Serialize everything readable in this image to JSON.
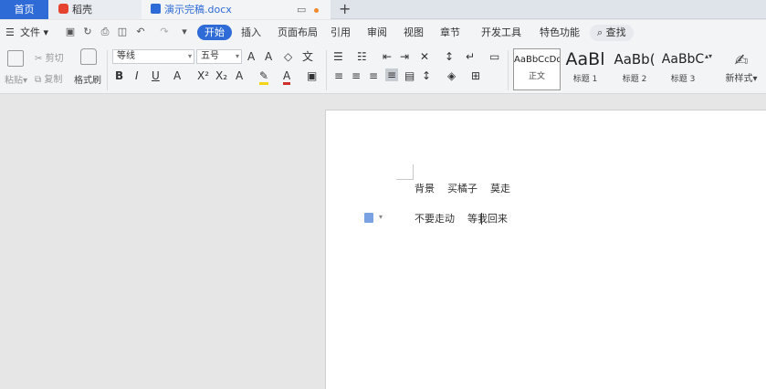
{
  "tabs": {
    "home": "首页",
    "daoke": "稻壳",
    "doc": "演示完稿.docx"
  },
  "menu": {
    "file": "文件",
    "items": [
      "开始",
      "插入",
      "页面布局",
      "引用",
      "审阅",
      "视图",
      "章节",
      "开发工具",
      "特色功能"
    ],
    "search": "查找"
  },
  "ribbon": {
    "paste": "粘贴",
    "cut": "剪切",
    "copy": "复制",
    "format_painter": "格式刷",
    "font_name": "等线",
    "font_size": "五号",
    "bold": "B",
    "italic": "I",
    "underline": "U",
    "styles": [
      {
        "sample": "AaBbCcDd",
        "label": "正文"
      },
      {
        "sample": "AaBl",
        "label": "标题 1"
      },
      {
        "sample": "AaBb(",
        "label": "标题 2"
      },
      {
        "sample": "AaBbC",
        "label": "标题 3"
      }
    ],
    "new_style": "新样式"
  },
  "document": {
    "line1": "背景    买橘子    莫走",
    "line2": "不要走动    等我回来"
  },
  "colors": {
    "accent": "#2f6bd6",
    "daoke": "#e5432f",
    "unsaved_dot": "#f28a2c"
  }
}
